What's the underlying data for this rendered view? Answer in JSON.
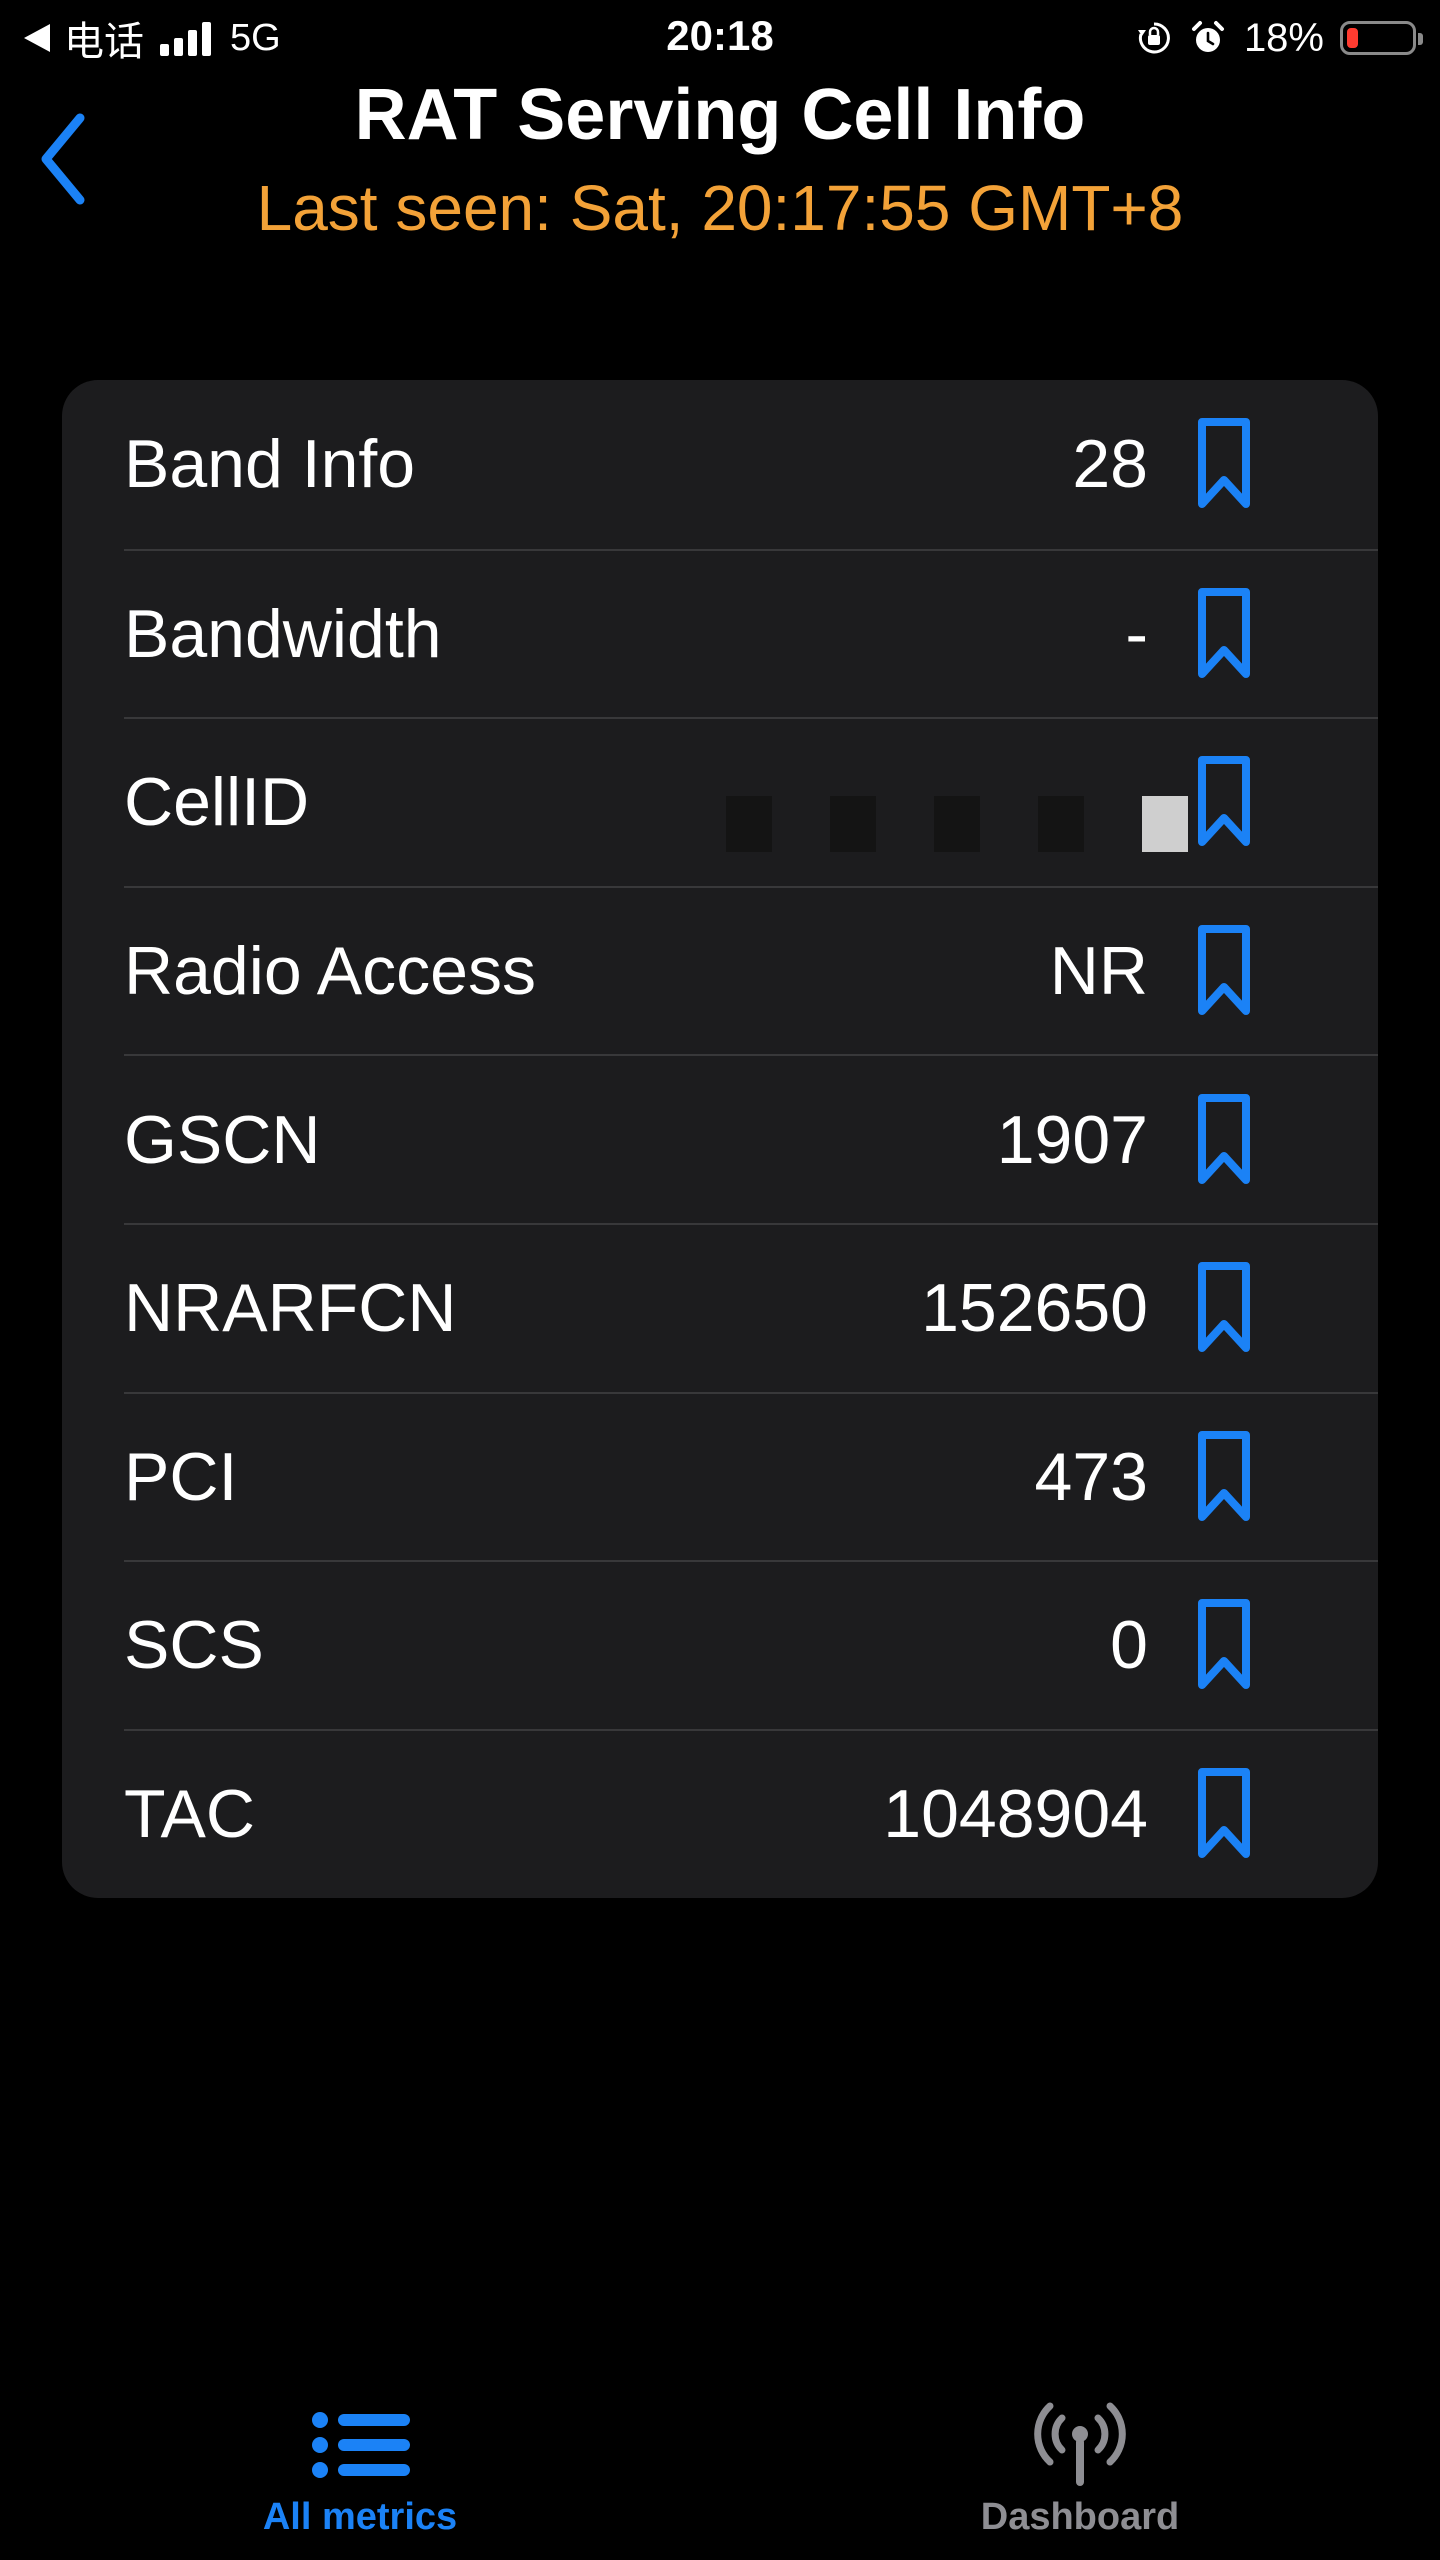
{
  "status_bar": {
    "carrier": "电话",
    "network": "5G",
    "time": "20:18",
    "battery": "18%",
    "battery_level": 0.18
  },
  "header": {
    "title": "RAT Serving Cell Info",
    "subtitle": "Last seen: Sat, 20:17:55 GMT+8"
  },
  "rows": [
    {
      "label": "Band Info",
      "value": "28"
    },
    {
      "label": "Bandwidth",
      "value": "-"
    },
    {
      "label": "CellID",
      "value": "4"
    },
    {
      "label": "Radio Access",
      "value": "NR"
    },
    {
      "label": "GSCN",
      "value": "1907"
    },
    {
      "label": "NRARFCN",
      "value": "152650"
    },
    {
      "label": "PCI",
      "value": "473"
    },
    {
      "label": "SCS",
      "value": "0"
    },
    {
      "label": "TAC",
      "value": "1048904"
    }
  ],
  "tabs": [
    {
      "label": "All metrics",
      "icon": "list-icon",
      "active": true
    },
    {
      "label": "Dashboard",
      "icon": "antenna-icon",
      "active": false
    }
  ],
  "colors": {
    "accent": "#1b82f6",
    "subtitle": "#f3a238",
    "card": "#1c1c1e",
    "battery_low": "#ff3b30"
  }
}
